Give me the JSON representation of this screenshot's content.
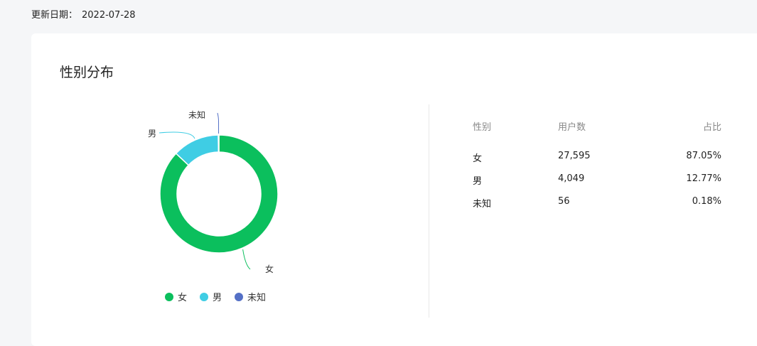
{
  "header": {
    "update_label": "更新日期：",
    "update_date": "2022-07-28"
  },
  "card": {
    "title": "性别分布"
  },
  "table": {
    "headers": [
      "性别",
      "用户数",
      "占比"
    ],
    "rows": [
      {
        "gender": "女",
        "users": "27,595",
        "share": "87.05%"
      },
      {
        "gender": "男",
        "users": "4,049",
        "share": "12.77%"
      },
      {
        "gender": "未知",
        "users": "56",
        "share": "0.18%"
      }
    ]
  },
  "chart_data": {
    "type": "pie",
    "variant": "donut",
    "title": "性别分布",
    "categories": [
      "女",
      "男",
      "未知"
    ],
    "values": [
      27595,
      4049,
      56
    ],
    "percentages": [
      87.05,
      12.77,
      0.18
    ],
    "colors": [
      "#0bbf5d",
      "#3fcde4",
      "#5470c6"
    ],
    "legend": [
      "女",
      "男",
      "未知"
    ],
    "legend_position": "bottom"
  }
}
